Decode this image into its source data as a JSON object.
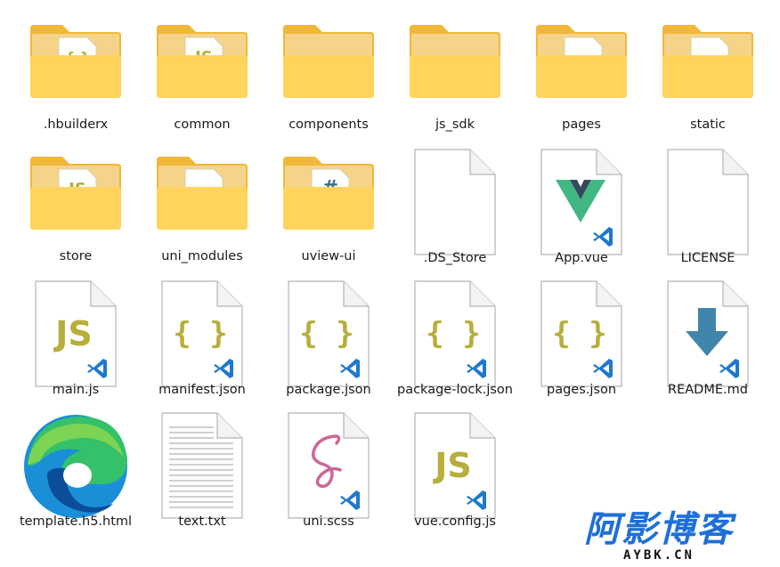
{
  "items": [
    {
      "id": "hbuilderx",
      "label": ".hbuilderx",
      "type": "folder",
      "inner": "json"
    },
    {
      "id": "common",
      "label": "common",
      "type": "folder",
      "inner": "js"
    },
    {
      "id": "components",
      "label": "components",
      "type": "folder",
      "inner": "none"
    },
    {
      "id": "js_sdk",
      "label": "js_sdk",
      "type": "folder",
      "inner": "none"
    },
    {
      "id": "pages",
      "label": "pages",
      "type": "folder",
      "inner": "doc"
    },
    {
      "id": "static",
      "label": "static",
      "type": "folder",
      "inner": "doc"
    },
    {
      "id": "store",
      "label": "store",
      "type": "folder",
      "inner": "js"
    },
    {
      "id": "uni_modules",
      "label": "uni_modules",
      "type": "folder",
      "inner": "doc"
    },
    {
      "id": "uview-ui",
      "label": "uview-ui",
      "type": "folder",
      "inner": "hash"
    },
    {
      "id": "ds_store",
      "label": ".DS_Store",
      "type": "file",
      "icon": "blank"
    },
    {
      "id": "app_vue",
      "label": "App.vue",
      "type": "file",
      "icon": "vue"
    },
    {
      "id": "license",
      "label": "LICENSE",
      "type": "file",
      "icon": "blank"
    },
    {
      "id": "main_js",
      "label": "main.js",
      "type": "file",
      "icon": "js"
    },
    {
      "id": "manifest_json",
      "label": "manifest.json",
      "type": "file",
      "icon": "json"
    },
    {
      "id": "package_json",
      "label": "package.json",
      "type": "file",
      "icon": "json"
    },
    {
      "id": "package_lock_json",
      "label": "package-lock.json",
      "type": "file",
      "icon": "json"
    },
    {
      "id": "pages_json",
      "label": "pages.json",
      "type": "file",
      "icon": "json"
    },
    {
      "id": "readme_md",
      "label": "README.md",
      "type": "file",
      "icon": "md"
    },
    {
      "id": "template_html",
      "label": "template.h5.html",
      "type": "file",
      "icon": "edge"
    },
    {
      "id": "text_txt",
      "label": "text.txt",
      "type": "file",
      "icon": "txt"
    },
    {
      "id": "uni_scss",
      "label": "uni.scss",
      "type": "file",
      "icon": "sass"
    },
    {
      "id": "vue_config_js",
      "label": "vue.config.js",
      "type": "file",
      "icon": "js"
    }
  ],
  "badge_text": {
    "js": "JS",
    "json": "{ }",
    "hash": "#"
  },
  "colors": {
    "folder_back": "#f0b73a",
    "folder_front": "#ffd35c",
    "folder_tab": "#e9a92a",
    "js_text": "#b7ae3b",
    "json_text": "#b7ae3b",
    "vscode": "#1e78d0",
    "vue_green": "#41b883",
    "vue_dark": "#35495e",
    "md_arrow": "#3f86aa",
    "sass_pink": "#cc6699",
    "watermark_blue": "#1e6fd9"
  },
  "watermark": {
    "title": "阿影博客",
    "subtitle": "AYBK.CN"
  }
}
